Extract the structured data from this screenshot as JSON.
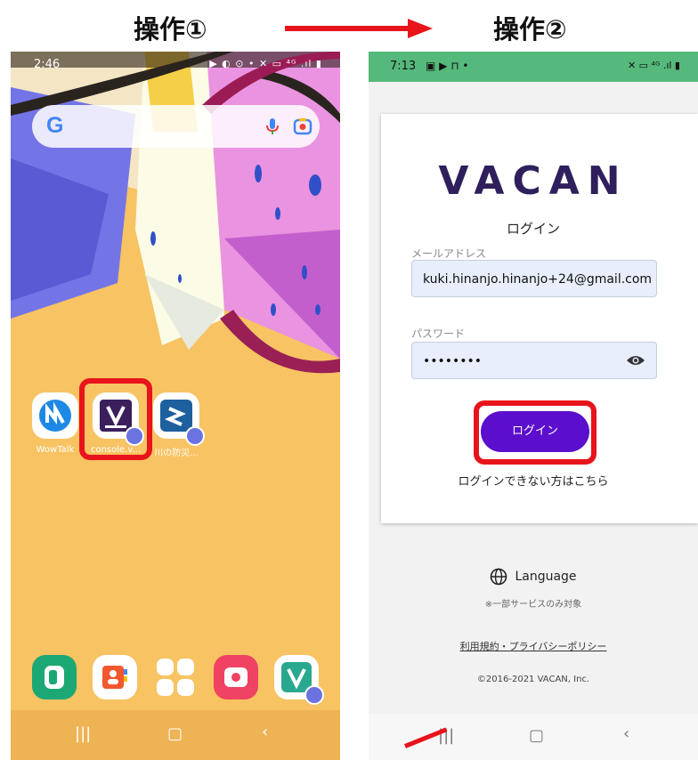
{
  "headings": {
    "step1": "操作①",
    "step2": "操作②"
  },
  "phone1": {
    "status": {
      "time": "2:46",
      "icons": "▶ ◐ ⊙ •      ✕ ▭ ⁴ᴳ .ıl ▮"
    },
    "search": {
      "logo": "G",
      "icons": [
        "mic-icon",
        "lens-icon"
      ]
    },
    "apps": [
      {
        "label": "WowTalk",
        "icon": "wowtalk-icon"
      },
      {
        "label": "console.v...",
        "icon": "vacan-admin-icon"
      },
      {
        "label": "川の防災...",
        "icon": "river-app-icon"
      }
    ],
    "dock": [
      "phone-icon",
      "contacts-icon",
      "apps-grid-icon",
      "camera-icon",
      "vacan-icon"
    ],
    "nav": [
      "|||",
      "▢",
      "‹"
    ]
  },
  "phone2": {
    "status": {
      "time": "7:13",
      "icons": "▣ ▶ ⊓ •",
      "right_icons": "✕ ▭ ⁴ᴳ .ıl ▮"
    },
    "logo": "VACAN",
    "login_title": "ログイン",
    "email_label": "メールアドレス",
    "email_value": "kuki.hinanjo.hinanjo+24@gmail.com",
    "password_label": "パスワード",
    "password_value": "••••••••",
    "login_button": "ログイン",
    "forgot_link": "ログインできない方はこちら",
    "language": "Language",
    "language_note": "※一部サービスのみ対象",
    "terms": "利用規約・プライバシーポリシー",
    "copyright": "©2016-2021 VACAN, Inc.",
    "nav": [
      "|||",
      "▢",
      "‹"
    ]
  },
  "colors": {
    "arrow": "#e8141b",
    "accent": "#5b0ecb",
    "status_bar": "#55b97b",
    "logo": "#2f1f5c"
  }
}
